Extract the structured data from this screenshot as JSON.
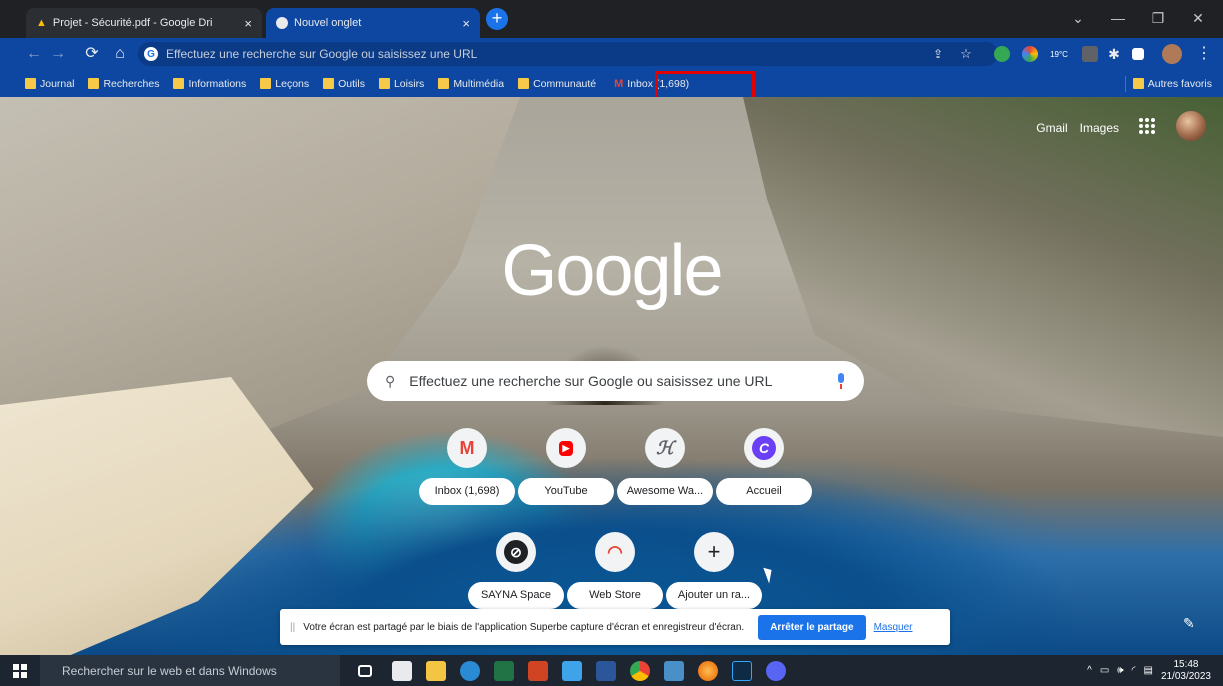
{
  "tabs": [
    {
      "title": "Projet - Sécurité.pdf - Google Dri",
      "close": "×"
    },
    {
      "title": "Nouvel onglet",
      "close": "×"
    }
  ],
  "new_tab_label": "+",
  "window_controls": {
    "chevron": "⌄",
    "minimize": "—",
    "restore": "❐",
    "close": "✕"
  },
  "omnibox": {
    "placeholder": "Effectuez une recherche sur Google ou saisissez une URL"
  },
  "weather_badge": "19°C",
  "bookmarks": [
    {
      "label": "Journal"
    },
    {
      "label": "Recherches"
    },
    {
      "label": "Informations"
    },
    {
      "label": "Leçons"
    },
    {
      "label": "Outils"
    },
    {
      "label": "Loisirs"
    },
    {
      "label": "Multimédia"
    },
    {
      "label": "Communauté"
    },
    {
      "label": "Inbox (1,698)"
    }
  ],
  "other_bookmarks": "Autres favoris",
  "top_links": {
    "gmail": "Gmail",
    "images": "Images"
  },
  "logo_text": "Google",
  "search": {
    "placeholder": "Effectuez une recherche sur Google ou saisissez une URL"
  },
  "shortcuts": [
    {
      "label": "Inbox (1,698)",
      "icon": "M",
      "color": "#ea4335"
    },
    {
      "label": "YouTube",
      "icon": "▶",
      "color": "#ff0000"
    },
    {
      "label": "Awesome Wa...",
      "icon": "ℋ",
      "color": "#5f6368"
    },
    {
      "label": "Accueil",
      "icon": "C",
      "color": "#6a3ff5"
    },
    {
      "label": "SAYNA Space",
      "icon": "⊘",
      "color": "#202124"
    },
    {
      "label": "Web Store",
      "icon": "◠",
      "color": "#fbbc04"
    },
    {
      "label": "Ajouter un ra...",
      "icon": "+",
      "color": "#202124"
    }
  ],
  "share_bar": {
    "grip": "||",
    "message": "Votre écran est partagé par le biais de l'application Superbe capture d'écran et enregistreur d'écran.",
    "stop": "Arrêter le partage",
    "hide": "Masquer"
  },
  "taskbar": {
    "search_placeholder": "Rechercher sur le web et dans Windows",
    "time": "15:48",
    "date": "21/03/2023"
  }
}
